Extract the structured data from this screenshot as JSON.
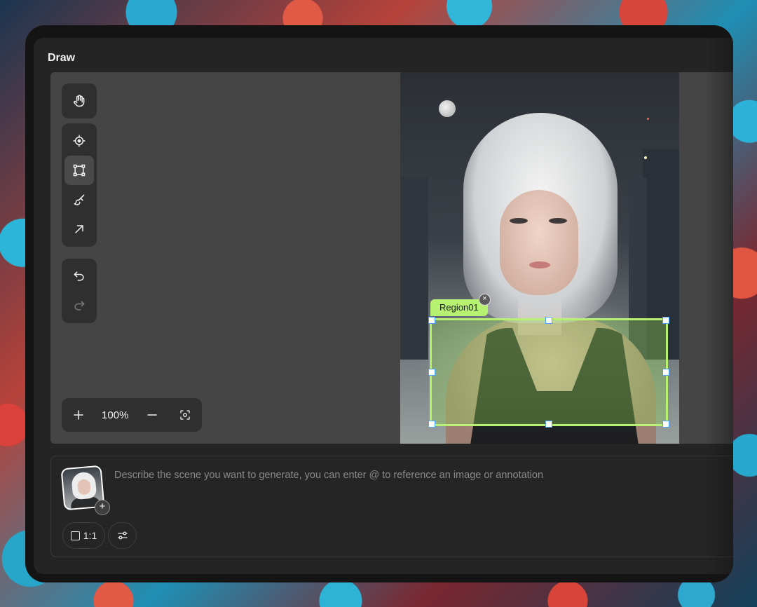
{
  "window": {
    "title": "Draw"
  },
  "toolbar": {
    "hand": "hand-icon",
    "tools": [
      "target-icon",
      "rectangle-select-icon",
      "brush-icon",
      "arrow-icon"
    ],
    "history": [
      "undo-icon",
      "redo-icon"
    ]
  },
  "zoom": {
    "value": "100%"
  },
  "annotation": {
    "label": "Region01",
    "color": "#b6f171",
    "handle_color": "#4aa3ff"
  },
  "prompt": {
    "placeholder": "Describe the scene you want to generate, you can enter @ to reference an image or annotation",
    "add_symbol": "+",
    "close_symbol": "×",
    "ratio_label": "1:1"
  }
}
